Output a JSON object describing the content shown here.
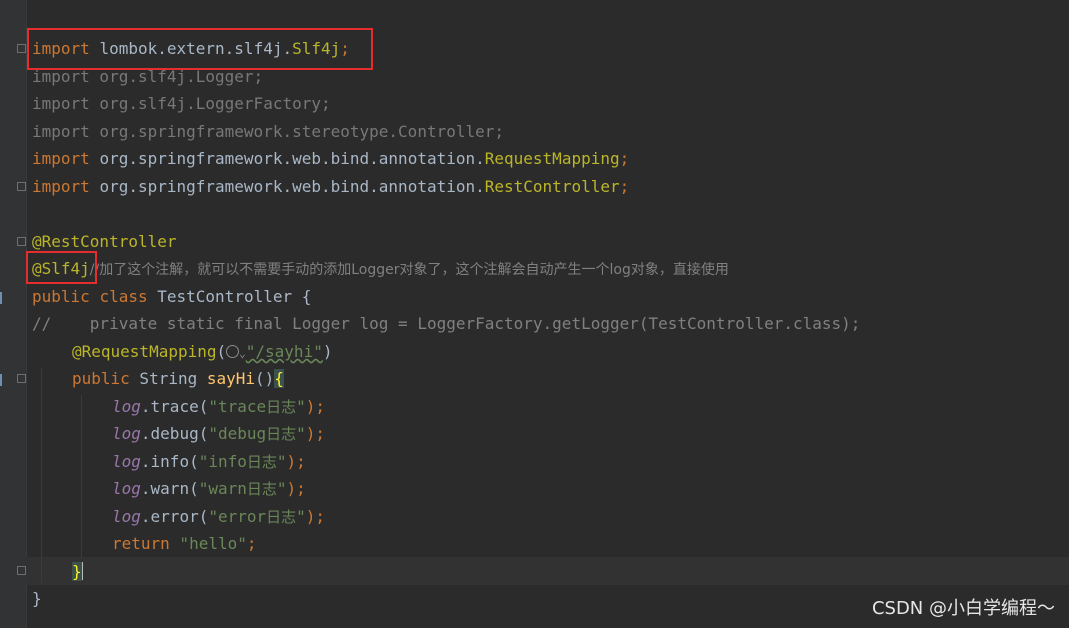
{
  "code": {
    "import_lombok": {
      "kw": "import",
      "pkg": "lombok.extern.slf4j.",
      "cls": "Slf4j",
      "end": ";"
    },
    "import_logger": "import org.slf4j.Logger;",
    "import_logger_factory": "import org.slf4j.LoggerFactory;",
    "import_controller": "import org.springframework.stereotype.Controller;",
    "import_request_mapping": {
      "kw": "import",
      "pkg": "org.springframework.web.bind.annotation.",
      "cls": "RequestMapping",
      "end": ";"
    },
    "import_rest_controller": {
      "kw": "import",
      "pkg": "org.springframework.web.bind.annotation.",
      "cls": "RestController",
      "end": ";"
    },
    "annotation_rest_controller": "@RestController",
    "annotation_slf4j": "@Slf4j",
    "annotation_slf4j_comment": "//加了这个注解，就可以不需要手动的添加Logger对象了，这个注解会自动产生一个log对象，直接使用",
    "class_decl": {
      "kw1": "public",
      "kw2": "class",
      "name": "TestController",
      "brace": " {"
    },
    "commented_logger": "//    private static final Logger log = LoggerFactory.getLogger(TestController.class);",
    "request_mapping": {
      "ann": "@RequestMapping",
      "open": "(",
      "path": "\"/sayhi\"",
      "close": ")"
    },
    "method_decl": {
      "kw": "public",
      "type": " String ",
      "name": "sayHi",
      "parens": "()",
      "brace": "{"
    },
    "log_calls": [
      {
        "var": "log",
        "method": ".trace(",
        "arg_a": "\"trace",
        "arg_cn": "日志",
        "arg_b": "\"",
        "end": ");"
      },
      {
        "var": "log",
        "method": ".debug(",
        "arg_a": "\"debug",
        "arg_cn": "日志",
        "arg_b": "\"",
        "end": ");"
      },
      {
        "var": "log",
        "method": ".info(",
        "arg_a": "\"info",
        "arg_cn": "日志",
        "arg_b": "\"",
        "end": ");"
      },
      {
        "var": "log",
        "method": ".warn(",
        "arg_a": "\"warn",
        "arg_cn": "日志",
        "arg_b": "\"",
        "end": ");"
      },
      {
        "var": "log",
        "method": ".error(",
        "arg_a": "\"error",
        "arg_cn": "日志",
        "arg_b": "\"",
        "end": ");"
      }
    ],
    "return_stmt": {
      "kw": "return",
      "val": " \"hello\"",
      "end": ";"
    },
    "method_close": "}",
    "class_close": "}"
  },
  "watermark": "CSDN @小白学编程～",
  "colors": {
    "background": "#2b2b2b",
    "keyword": "#cc7832",
    "annotation": "#bbb529",
    "string": "#6a8759",
    "method": "#ffc66d",
    "field": "#9876aa",
    "comment": "#808080",
    "highlight_box": "#e52d2d"
  }
}
